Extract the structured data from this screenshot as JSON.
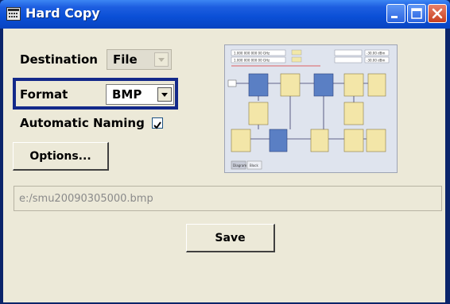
{
  "window": {
    "title": "Hard Copy"
  },
  "destination": {
    "label": "Destination",
    "value": "File"
  },
  "format": {
    "label": "Format",
    "value": "BMP"
  },
  "automatic_naming": {
    "label": "Automatic Naming",
    "checked": true
  },
  "buttons": {
    "options_label": "Options...",
    "save_label": "Save"
  },
  "file_path": {
    "value": "e:/smu20090305000.bmp"
  },
  "preview": {
    "freq_a": "1.000 000 000 00 GHz",
    "freq_b": "1.000 000 000 00 GHz",
    "level_a": "-30.00 dBm",
    "level_b": "-30.00 dBm",
    "tab_1": "Diagram",
    "tab_2": "Block"
  },
  "colors": {
    "title_bar": "#0a4fd6",
    "focus_frame": "#13298a",
    "client_bg": "#ece9d8"
  }
}
